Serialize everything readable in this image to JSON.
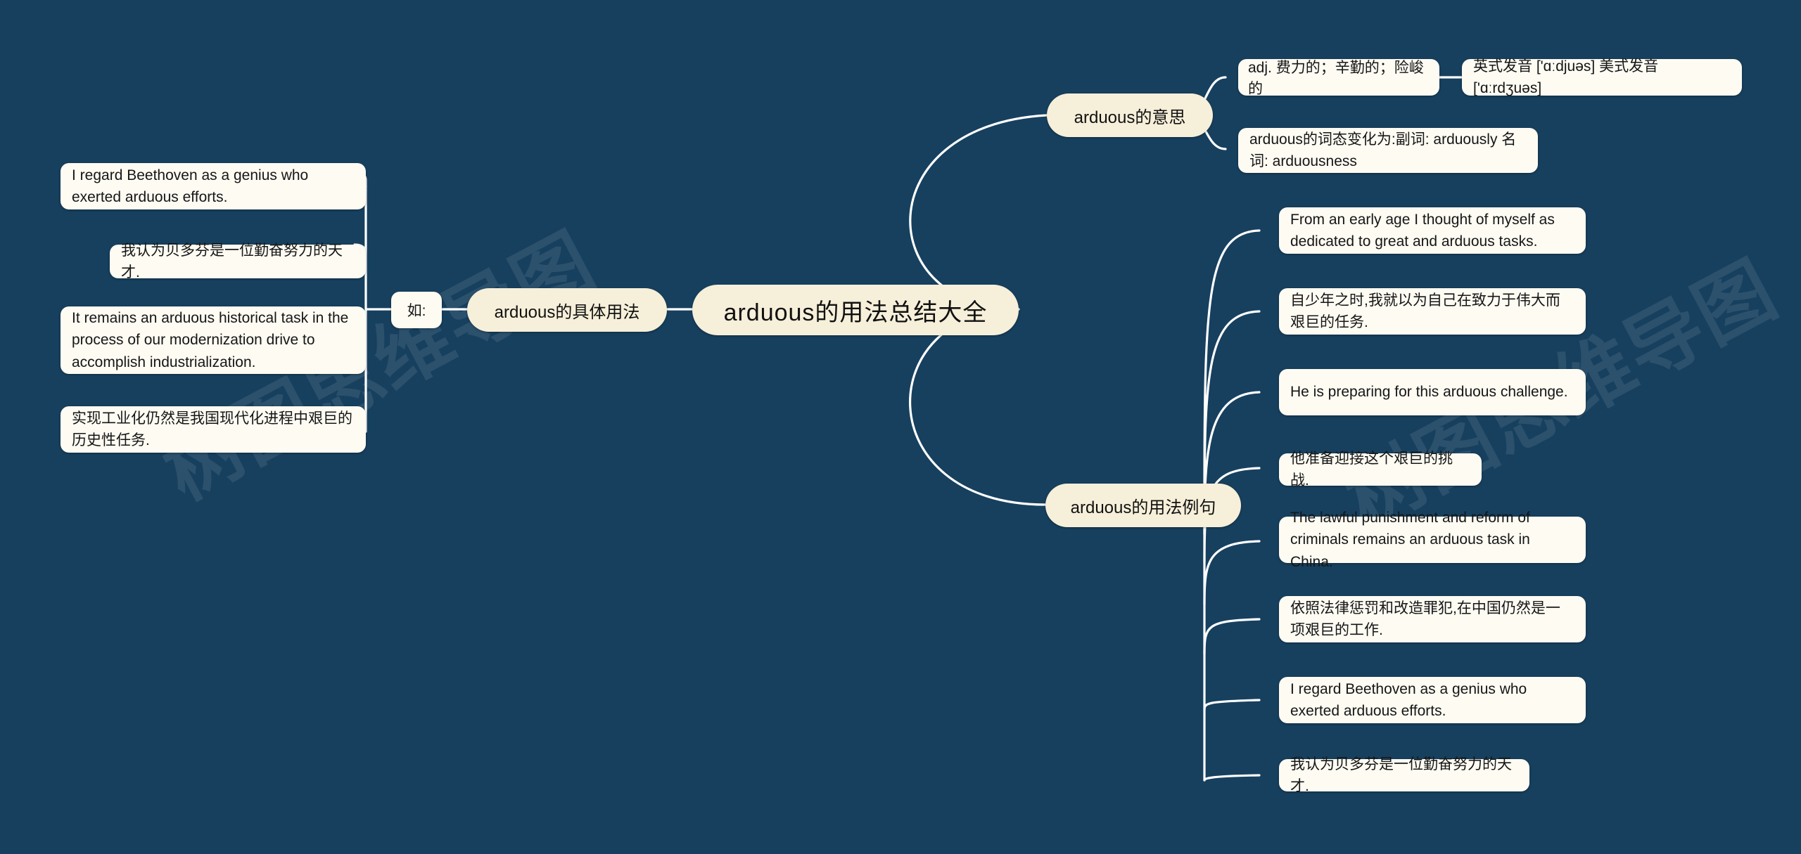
{
  "background_color": "#17405f",
  "node_fill": "#fdfbf2",
  "branch_fill": "#f6efd9",
  "connector_color": "#ffffff",
  "watermark": "树图思维导图",
  "root": {
    "label": "arduous的用法总结大全"
  },
  "branches": {
    "meaning": {
      "label": "arduous的意思",
      "children": [
        {
          "label": "adj. 费力的；辛勤的；险峻的"
        },
        {
          "label": "arduous的词态变化为:副词: arduously 名词: arduousness"
        }
      ],
      "pronunciation": "英式发音 ['ɑːdjuəs] 美式发音 ['ɑːrdʒuəs]"
    },
    "usage": {
      "label": "arduous的具体用法",
      "connector_label": "如:",
      "examples": [
        "I regard Beethoven as a genius who exerted arduous efforts.",
        "我认为贝多芬是一位勤奋努力的天才.",
        "It remains an arduous historical task in the process of our modernization drive to accomplish industrialization.",
        "实现工业化仍然是我国现代化进程中艰巨的历史性任务."
      ]
    },
    "sentences": {
      "label": "arduous的用法例句",
      "examples": [
        "From an early age I thought of myself as dedicated to great and arduous tasks.",
        "自少年之时,我就以为自己在致力于伟大而艰巨的任务.",
        "He is preparing for this arduous challenge.",
        "他准备迎接这个艰巨的挑战.",
        "The lawful punishment and reform of criminals remains an arduous task in China.",
        "依照法律惩罚和改造罪犯,在中国仍然是一项艰巨的工作.",
        "I regard Beethoven as a genius who exerted arduous efforts.",
        "我认为贝多芬是一位勤奋努力的天才."
      ]
    }
  }
}
